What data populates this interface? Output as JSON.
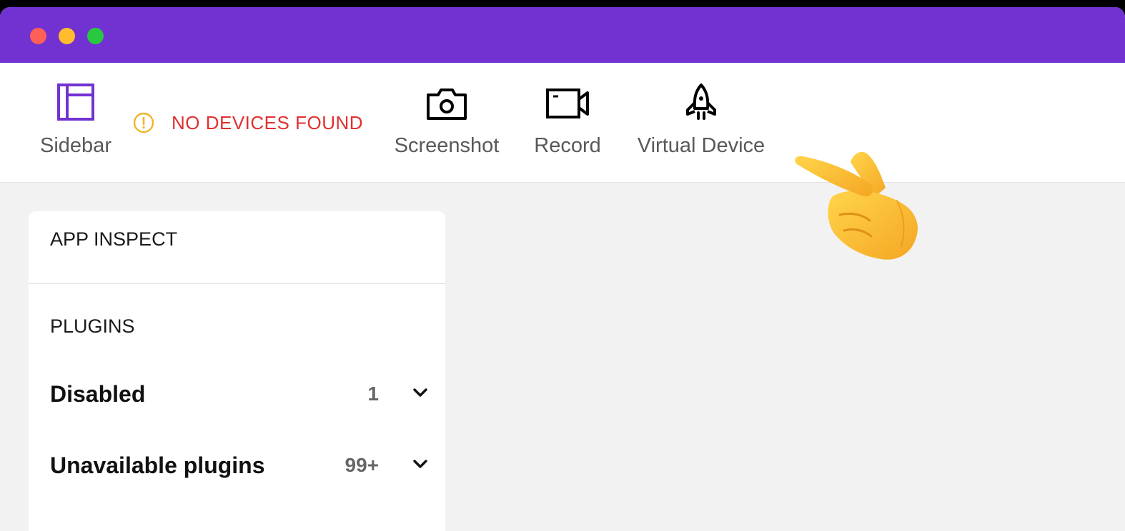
{
  "titlebar": {
    "traffic_lights": [
      "close",
      "minimize",
      "zoom"
    ],
    "background_color": "#7232d2"
  },
  "toolbar": {
    "sidebar_label": "Sidebar",
    "sidebar_icon": "sidebar-layout-icon",
    "accent_color": "#7232d2",
    "warning": {
      "icon": "exclamation-circle-icon",
      "text": "NO DEVICES FOUND",
      "color": "#e0302f"
    },
    "screenshot_label": "Screenshot",
    "record_label": "Record",
    "virtual_device_label": "Virtual Device"
  },
  "sidebar_panel": {
    "header": "APP INSPECT",
    "section_title": "PLUGINS",
    "groups": [
      {
        "label": "Disabled",
        "count": "1"
      },
      {
        "label": "Unavailable plugins",
        "count": "99+"
      }
    ]
  },
  "decoration": {
    "pointer": "pointing-hand-emoji"
  }
}
